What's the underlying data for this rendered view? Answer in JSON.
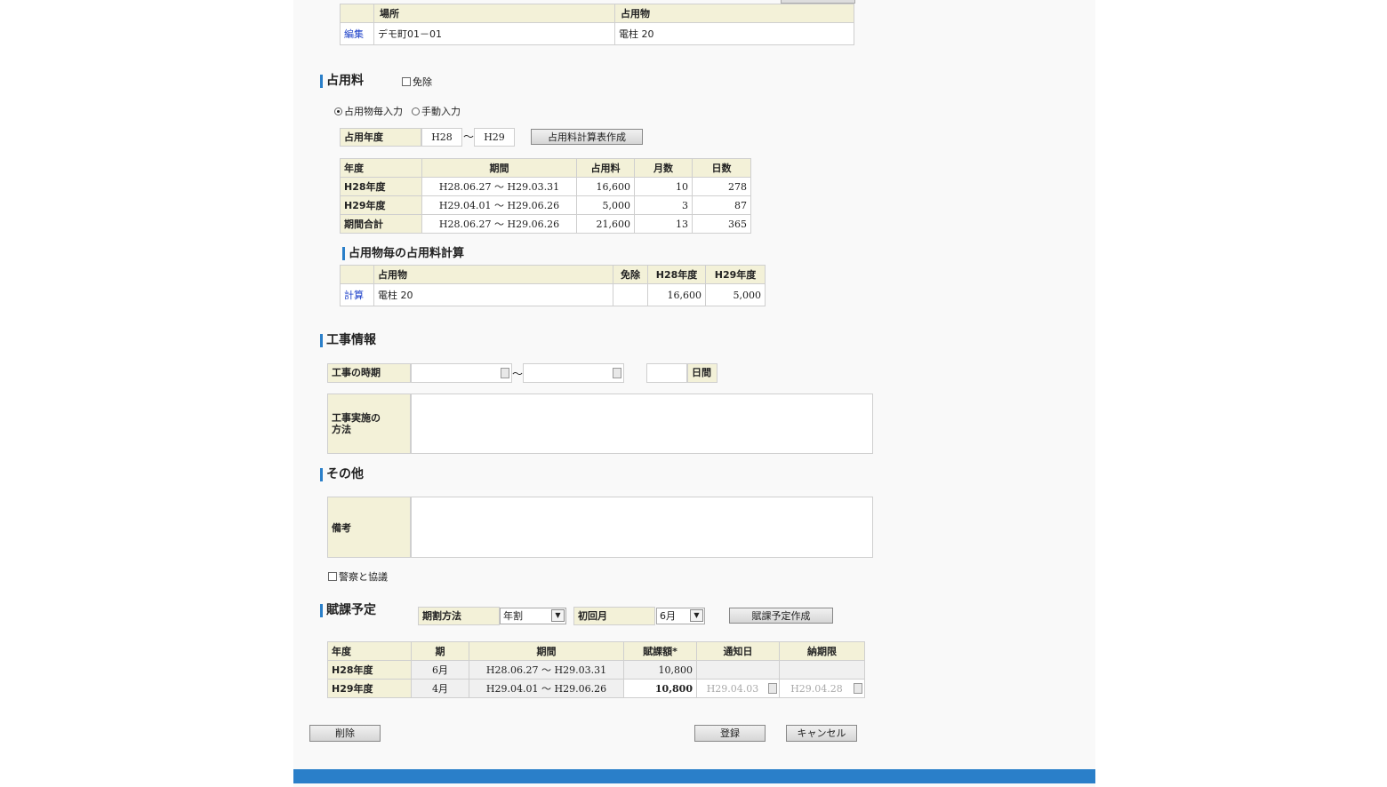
{
  "location_table": {
    "headers": [
      "",
      "場所",
      "占用物"
    ],
    "rows": [
      {
        "action": "編集",
        "place": "デモ町01－01",
        "object": "電柱 20"
      }
    ]
  },
  "fee": {
    "title": "占用料",
    "exempt_label": "免除",
    "radio_auto": "占用物毎入力",
    "radio_manual": "手動入力",
    "year_label": "占用年度",
    "year_from": "H28",
    "year_to": "H29",
    "tilde": "～",
    "calc_button": "占用料計算表作成",
    "table": {
      "headers": [
        "年度",
        "期間",
        "占用料",
        "月数",
        "日数"
      ],
      "rows": [
        {
          "year": "H28年度",
          "period": "H28.06.27 ～ H29.03.31",
          "fee": "16,600",
          "months": "10",
          "days": "278"
        },
        {
          "year": "H29年度",
          "period": "H29.04.01 ～ H29.06.26",
          "fee": "5,000",
          "months": "3",
          "days": "87"
        },
        {
          "year": "期間合計",
          "period": "H28.06.27 ～ H29.06.26",
          "fee": "21,600",
          "months": "13",
          "days": "365"
        }
      ]
    }
  },
  "per_object": {
    "title": "占用物毎の占用料計算",
    "headers": [
      "",
      "占用物",
      "免除",
      "H28年度",
      "H29年度"
    ],
    "rows": [
      {
        "action": "計算",
        "object": "電柱 20",
        "exempt": "",
        "h28": "16,600",
        "h29": "5,000"
      }
    ]
  },
  "construction": {
    "title": "工事情報",
    "period_label": "工事の時期",
    "tilde": "～",
    "days_unit": "日間",
    "method_label": "工事実施の方法"
  },
  "other": {
    "title": "その他",
    "remarks_label": "備考",
    "police_label": "警察と協議"
  },
  "schedule": {
    "title": "賦課予定",
    "method_label": "期割方法",
    "method_value": "年割",
    "first_month_label": "初回月",
    "first_month_value": "6月",
    "create_button": "賦課予定作成",
    "table": {
      "headers": [
        "年度",
        "期",
        "期間",
        "賦課額*",
        "通知日",
        "納期限"
      ],
      "rows": [
        {
          "year": "H28年度",
          "term": "6月",
          "period": "H28.06.27 ～ H29.03.31",
          "amount": "10,800",
          "notice": "",
          "due": ""
        },
        {
          "year": "H29年度",
          "term": "4月",
          "period": "H29.04.01 ～ H29.06.26",
          "amount": "10,800",
          "notice": "H29.04.03",
          "due": "H29.04.28"
        }
      ]
    }
  },
  "buttons": {
    "delete": "削除",
    "register": "登録",
    "cancel": "キャンセル"
  },
  "colors": {
    "accent": "#2a7fc9",
    "header_bg": "#f3f1d8",
    "link": "#1b3fc8"
  }
}
